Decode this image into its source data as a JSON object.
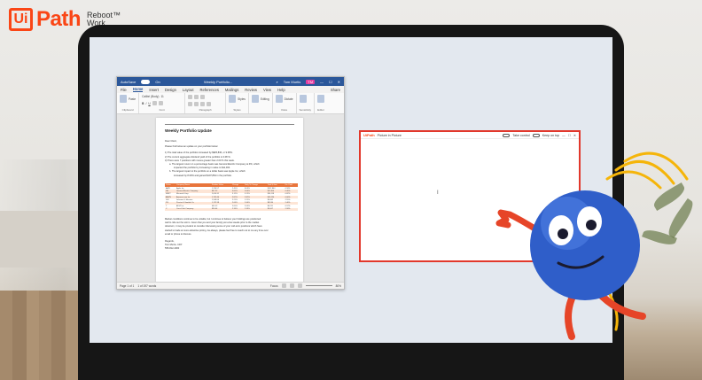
{
  "brand": {
    "logo_mark": "Ui",
    "logo_word": "Path",
    "tagline_line1": "Reboot™",
    "tagline_line2": "Work.",
    "accent": "#fa4616"
  },
  "word": {
    "title_left": "AutoSave",
    "toggle_state": "On",
    "doc_name": "Weekly Portfolio...",
    "search_icon": "search-icon",
    "user_name": "Tom Murtis",
    "user_initials": "TM",
    "tabs": [
      "File",
      "Home",
      "Insert",
      "Design",
      "Layout",
      "References",
      "Mailings",
      "Review",
      "View",
      "Help"
    ],
    "active_tab": "Home",
    "share": "Share",
    "ribbon": {
      "clipboard": "Clipboard",
      "paste": "Paste",
      "font_name": "Calibri (Body)",
      "font_size": "11",
      "font": "Font",
      "paragraph": "Paragraph",
      "styles": "Styles",
      "styles_group": "Styles",
      "editing": "Editing",
      "dictate": "Dictate",
      "voice": "Voice",
      "sensitivity": "Sensitivity",
      "editor": "Editor"
    },
    "document": {
      "title": "Weekly Portfolio Update",
      "greeting": "Dear Client,",
      "intro": "Please find below an update on your portfolio below:",
      "lines": [
        "1) The total value of the portfolio increased by $$25,836, or 9.68%.",
        "2) The current aggregate dividend yield of the portfolio is 3.08 %.",
        "3) There were 7 positions with moves greater than 2.00 % this week.",
        "a. The largest mover on a percentage basis was General Electric Company at 9%, which",
        "impacted the portfolio by increasing in value to $11,304.",
        "b. The largest impact to the portfolio on a dollar basis was Apple Inc, which",
        "increased by 8.09% and gained $107,864 in the portfolio."
      ],
      "table_headers": [
        "Ticker",
        "Company Name",
        "Position Value",
        "Change",
        "Daily % Change",
        "Total $ Gain",
        "Div Yield"
      ],
      "table_rows": [
        [
          "AAPL",
          "Apple Inc",
          "1,234.57",
          "2.45%",
          "8.09%",
          "$107,864",
          "0.58%"
        ],
        [
          "GE",
          "General Electric Company",
          "847.52",
          "9.00%",
          "9.00%",
          "$11,304",
          "0.40%"
        ],
        [
          "MSFT",
          "Microsoft Corp",
          "2,056.31",
          "3.12%",
          "3.12%",
          "$24,118",
          "0.82%"
        ],
        [
          "AMZN",
          "Amazon.com Inc",
          "1,732.40",
          "2.87%",
          "2.87%",
          "$19,226",
          "0.00%"
        ],
        [
          "JNJ",
          "Johnson & Johnson",
          "1,568.90",
          "2.21%",
          "2.21%",
          "$9,842",
          "2.55%"
        ],
        [
          "PG",
          "Procter & Gamble Co",
          "1,122.38",
          "2.64%",
          "2.64%",
          "$8,530",
          "2.46%"
        ],
        [
          "T",
          "AT&T Inc",
          "645.12",
          "2.05%",
          "2.05%",
          "$4,211",
          "6.12%"
        ],
        [
          "C",
          "Coca-Cola Company",
          "896.44",
          "2.33%",
          "2.33%",
          "$5,007",
          "2.98%"
        ]
      ],
      "closing": [
        "Market conditions continue to be volatile, but I continue to believe your holdings are positioned",
        "well to ride out the storm. Given that you and your family just a few weeks prior to the market",
        "downturn, it may be prudent to consider discussing some of your mid-term positions which have",
        "started to trade at more attractive pricing. As always, please feel free to reach out to me any time over",
        "email or phone to discuss."
      ],
      "signoff": "Regards,",
      "signer": "Tom Murtis, CFP",
      "phone": "555-812-4000"
    },
    "status": {
      "page": "Page 1 of 1",
      "words": "1 of 197 words",
      "focus": "Focus",
      "zoom": "80%"
    }
  },
  "pip": {
    "logo": "UiPath",
    "title": "Picture in Picture",
    "take_control": "Take control",
    "keep_on_top": "Keep on top",
    "border_color": "#e2382c"
  }
}
